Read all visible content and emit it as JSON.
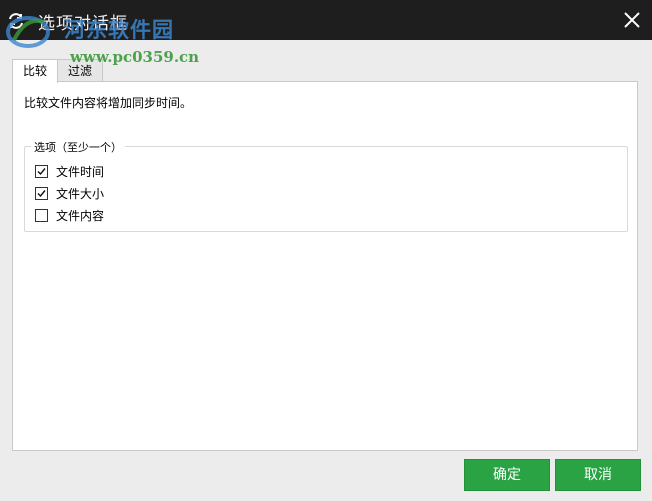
{
  "window": {
    "title": "选项对话框",
    "close_label": "×"
  },
  "watermark": {
    "site_name": "河东软件园",
    "site_url": "www.pc0359.cn"
  },
  "tabs": [
    {
      "label": "比较",
      "active": true
    },
    {
      "label": "过滤",
      "active": false
    }
  ],
  "compare": {
    "description": "比较文件内容将增加同步时间。",
    "group_label": "选项（至少一个）",
    "options": [
      {
        "label": "文件时间",
        "checked": true
      },
      {
        "label": "文件大小",
        "checked": true
      },
      {
        "label": "文件内容",
        "checked": false
      }
    ]
  },
  "buttons": {
    "ok": "确定",
    "cancel": "取消"
  },
  "colors": {
    "titlebar": "#1e1e1e",
    "accent": "#2aa344",
    "watermark_blue": "#3b86cf",
    "watermark_green": "#3a9a3a"
  }
}
